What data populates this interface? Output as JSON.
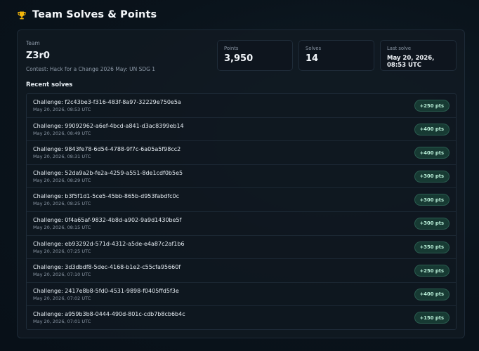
{
  "header": {
    "title": "Team Solves & Points",
    "icon": "trophy-icon",
    "icon_color": "#f5b70a"
  },
  "team": {
    "label": "Team",
    "name": "Z3r0",
    "contest": "Contest: Hack for a Change 2026 May: UN SDG 1"
  },
  "stats": {
    "points": {
      "label": "Points",
      "value": "3,950"
    },
    "solves": {
      "label": "Solves",
      "value": "14"
    },
    "last_solve": {
      "label": "Last solve",
      "value": "May 20, 2026, 08:53 UTC"
    }
  },
  "recent": {
    "title": "Recent solves",
    "items": [
      {
        "challenge": "Challenge: f2c43be3-f316-483f-8a97-32229e750e5a",
        "time": "May 20, 2026, 08:53 UTC",
        "points": "+250 pts"
      },
      {
        "challenge": "Challenge: 99092962-a6ef-4bcd-a841-d3ac8399eb14",
        "time": "May 20, 2026, 08:49 UTC",
        "points": "+400 pts"
      },
      {
        "challenge": "Challenge: 9843fe78-6d54-4788-9f7c-6a05a5f98cc2",
        "time": "May 20, 2026, 08:31 UTC",
        "points": "+400 pts"
      },
      {
        "challenge": "Challenge: 52da9a2b-fe2a-4259-a551-8de1cdf0b5e5",
        "time": "May 20, 2026, 08:29 UTC",
        "points": "+300 pts"
      },
      {
        "challenge": "Challenge: b3f5f1d1-5ce5-45bb-865b-d953fabdfc0c",
        "time": "May 20, 2026, 08:25 UTC",
        "points": "+300 pts"
      },
      {
        "challenge": "Challenge: 0f4a65af-9832-4b8d-a902-9a9d1430be5f",
        "time": "May 20, 2026, 08:15 UTC",
        "points": "+300 pts"
      },
      {
        "challenge": "Challenge: eb93292d-571d-4312-a5de-e4a87c2af1b6",
        "time": "May 20, 2026, 07:25 UTC",
        "points": "+350 pts"
      },
      {
        "challenge": "Challenge: 3d3dbdf8-5dec-4168-b1e2-c55cfa95660f",
        "time": "May 20, 2026, 07:10 UTC",
        "points": "+250 pts"
      },
      {
        "challenge": "Challenge: 2417e8b8-5fd0-4531-9898-f0405ffd5f3e",
        "time": "May 20, 2026, 07:02 UTC",
        "points": "+400 pts"
      },
      {
        "challenge": "Challenge: a959b3b8-0444-490d-801c-cdb7b8cb6b4c",
        "time": "May 20, 2026, 07:01 UTC",
        "points": "+150 pts"
      }
    ]
  }
}
